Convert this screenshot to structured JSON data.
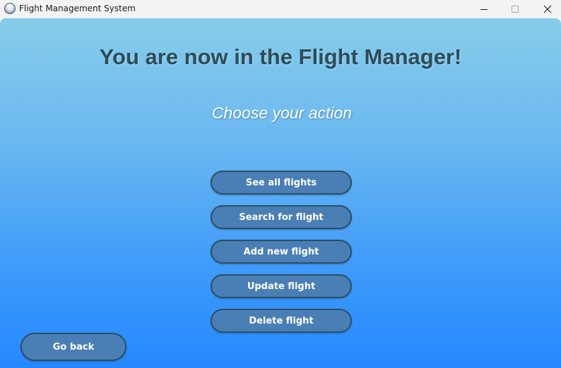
{
  "window": {
    "title": "Flight Management System",
    "icon": "globe-app-icon"
  },
  "main": {
    "heading": "You are now in the Flight Manager!",
    "subheading": "Choose your action",
    "actions": [
      {
        "label": "See all flights"
      },
      {
        "label": "Search for flight"
      },
      {
        "label": "Add new flight"
      },
      {
        "label": "Update flight"
      },
      {
        "label": "Delete flight"
      }
    ],
    "back_label": "Go back"
  },
  "colors": {
    "background_top": "#86cdea",
    "background_bottom": "#2588ff",
    "button_fill": "#4a7fb5",
    "button_border": "#2f4f63",
    "heading_text": "#2e4c58"
  }
}
